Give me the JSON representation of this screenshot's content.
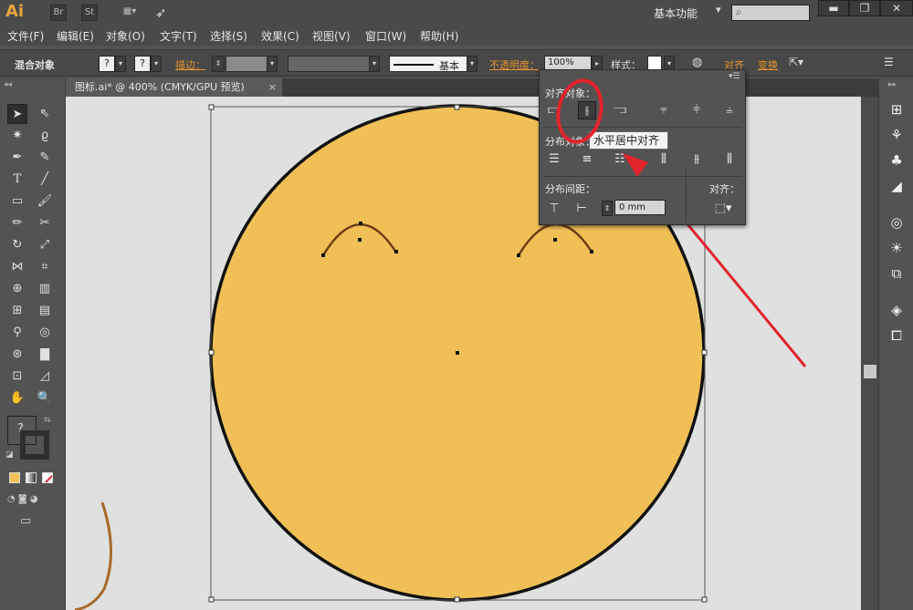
{
  "app": {
    "logo": "Ai",
    "bridge_btn": "Br",
    "stock_btn": "St",
    "workspace": "基本功能"
  },
  "menu": [
    "文件(F)",
    "编辑(E)",
    "对象(O)",
    "文字(T)",
    "选择(S)",
    "效果(C)",
    "视图(V)",
    "窗口(W)",
    "帮助(H)"
  ],
  "control": {
    "selection_label": "混合对象",
    "stroke_label": "描边：",
    "brush_label": "基本",
    "opacity_label": "不透明度：",
    "opacity_value": "100%",
    "style_label": "样式：",
    "align_link": "对齐",
    "transform_link": "变换"
  },
  "document": {
    "tab_title": "图标.ai* @ 400% (CMYK/GPU 预览)",
    "close": "×"
  },
  "align_panel": {
    "align_objects_label": "对齐对象：",
    "distribute_objects_label": "分布对象：",
    "distribute_spacing_label": "分布间距：",
    "spacing_value": "0 mm",
    "align_to_label": "对齐：",
    "tooltip": "水平居中对齐"
  },
  "colors": {
    "face_fill": "#f0c057",
    "accent_orange": "#e8952e",
    "highlight_red": "#e3232c",
    "brown_stroke": "#a86a2a"
  }
}
